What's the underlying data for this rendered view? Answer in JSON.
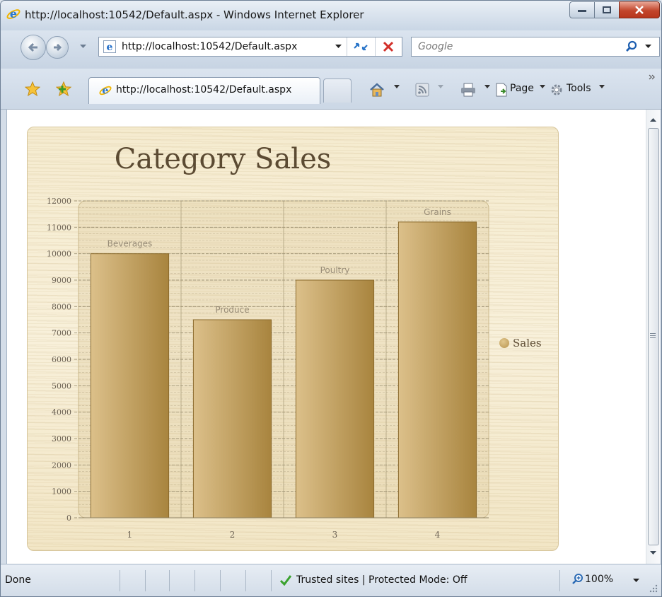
{
  "window": {
    "title": "http://localhost:10542/Default.aspx - Windows Internet Explorer"
  },
  "address_bar": {
    "url": "http://localhost:10542/Default.aspx",
    "search_placeholder": "Google"
  },
  "tab": {
    "label": "http://localhost:10542/Default.aspx"
  },
  "command_bar": {
    "page_label": "Page",
    "tools_label": "Tools"
  },
  "status_bar": {
    "status": "Done",
    "zone": "Trusted sites | Protected Mode: Off",
    "zoom": "100%"
  },
  "colors": {
    "bar_light": "#dcc08a",
    "bar_dark": "#a8843e",
    "title_text": "#5b4a32",
    "axis_text": "#6b6153"
  },
  "chart_data": {
    "type": "bar",
    "title": "Category Sales",
    "categories": [
      "1",
      "2",
      "3",
      "4"
    ],
    "series": [
      {
        "name": "Sales",
        "values": [
          10000,
          7500,
          9000,
          11200
        ],
        "point_labels": [
          "Beverages",
          "Produce",
          "Poultry",
          "Grains"
        ]
      }
    ],
    "ylim": [
      0,
      12000
    ],
    "yticks": [
      0,
      1000,
      2000,
      3000,
      4000,
      5000,
      6000,
      7000,
      8000,
      9000,
      10000,
      11000,
      12000
    ],
    "grid": true,
    "legend_position": "right"
  }
}
